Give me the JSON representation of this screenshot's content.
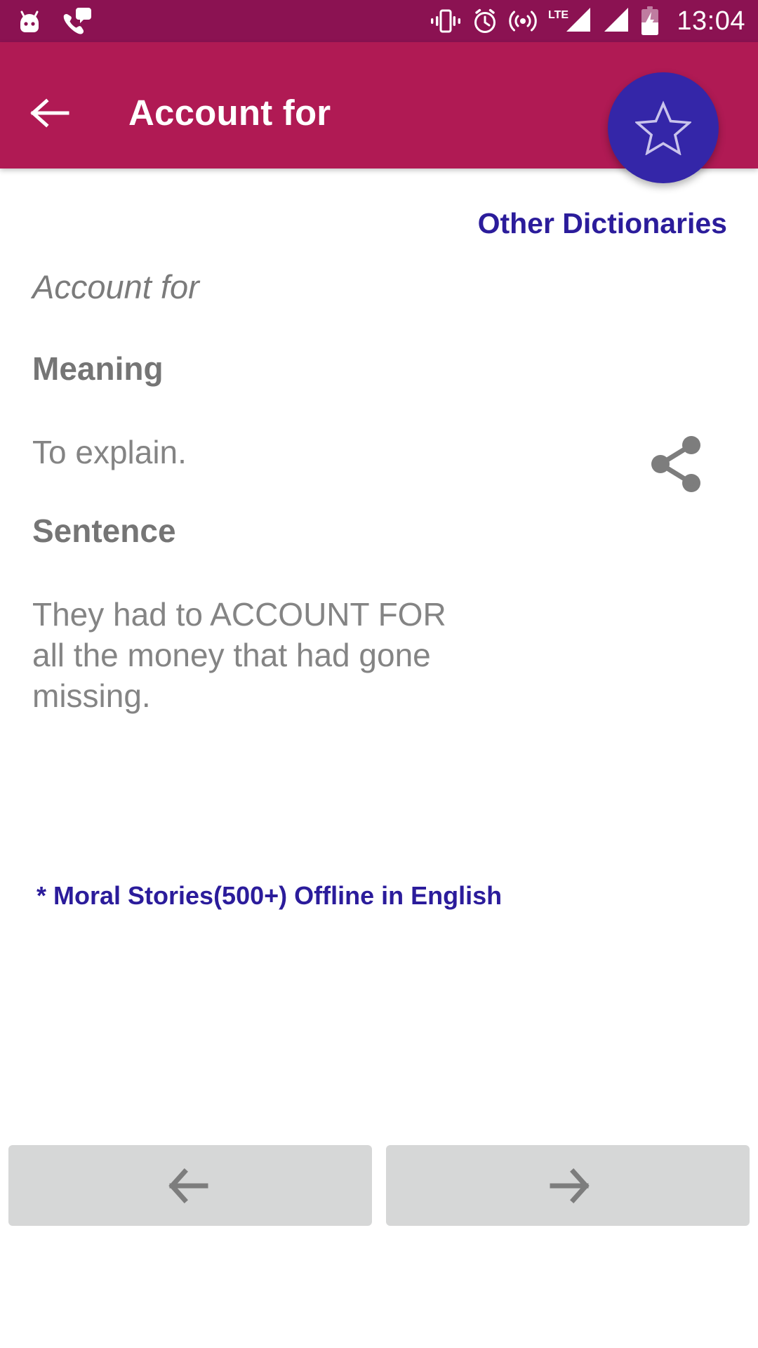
{
  "status_bar": {
    "background_color": "#8B1252",
    "time": "13:04",
    "left_icons": [
      {
        "name": "android-mascot-icon"
      },
      {
        "name": "voicemail-call-icon"
      }
    ],
    "right_icons": [
      {
        "name": "vibrate-icon"
      },
      {
        "name": "alarm-clock-icon"
      },
      {
        "name": "hotspot-icon"
      },
      {
        "name": "lte-label-icon",
        "label": "LTE"
      },
      {
        "name": "signal-bars-sim1-icon"
      },
      {
        "name": "signal-bars-sim2-icon"
      },
      {
        "name": "battery-charging-icon"
      }
    ]
  },
  "app_bar": {
    "background_color": "#B01A54",
    "title": "Account for",
    "back_icon": "back-arrow-icon",
    "fab": {
      "icon": "star-outline-icon",
      "color": "#3426A8"
    }
  },
  "content": {
    "other_dictionaries_label": "Other Dictionaries",
    "link_color": "#2B1C9B",
    "word": "Account for",
    "share_icon": "share-icon",
    "meaning_heading": "Meaning",
    "meaning_text": "To explain.",
    "sentence_heading": "Sentence",
    "sentence_text": "They had to ACCOUNT FOR all the money that had gone missing.",
    "promo_link": "* Moral Stories(500+) Offline in English",
    "text_color": "#757575"
  },
  "bottom_nav": {
    "background_color": "#D6D7D7",
    "previous_icon": "arrow-left-icon",
    "next_icon": "arrow-right-icon",
    "previous_label": "",
    "next_label": ""
  }
}
